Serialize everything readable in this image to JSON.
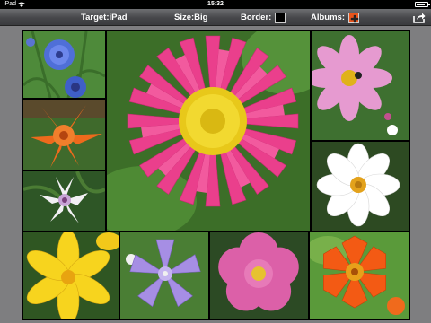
{
  "status": {
    "carrier": "iPad",
    "time": "15:32",
    "battery_level": 0.85
  },
  "toolbar": {
    "target_label": "Target:iPad",
    "size_label": "Size:Big",
    "border_label": "Border:",
    "albums_label": "Albums:",
    "border_color": "#000000",
    "albums_color": "#e8541b",
    "share_icon": "share-icon"
  },
  "collage": {
    "tiles": [
      {
        "id": "blue-cornflower",
        "color": "#4f6fd8"
      },
      {
        "id": "orange-lily",
        "color": "#ee6a1c"
      },
      {
        "id": "white-bellflower",
        "color": "#f2f0f4"
      },
      {
        "id": "pink-daisy",
        "color": "#ea3f8c"
      },
      {
        "id": "pink-cosmos",
        "color": "#e69ad0"
      },
      {
        "id": "white-cosmos",
        "color": "#ffffff"
      },
      {
        "id": "yellow-lily",
        "color": "#f7d41e"
      },
      {
        "id": "purple-bellflower",
        "color": "#a68ee4"
      },
      {
        "id": "pink-rose",
        "color": "#dc60a8"
      },
      {
        "id": "orange-poppy",
        "color": "#f35a14"
      }
    ]
  }
}
